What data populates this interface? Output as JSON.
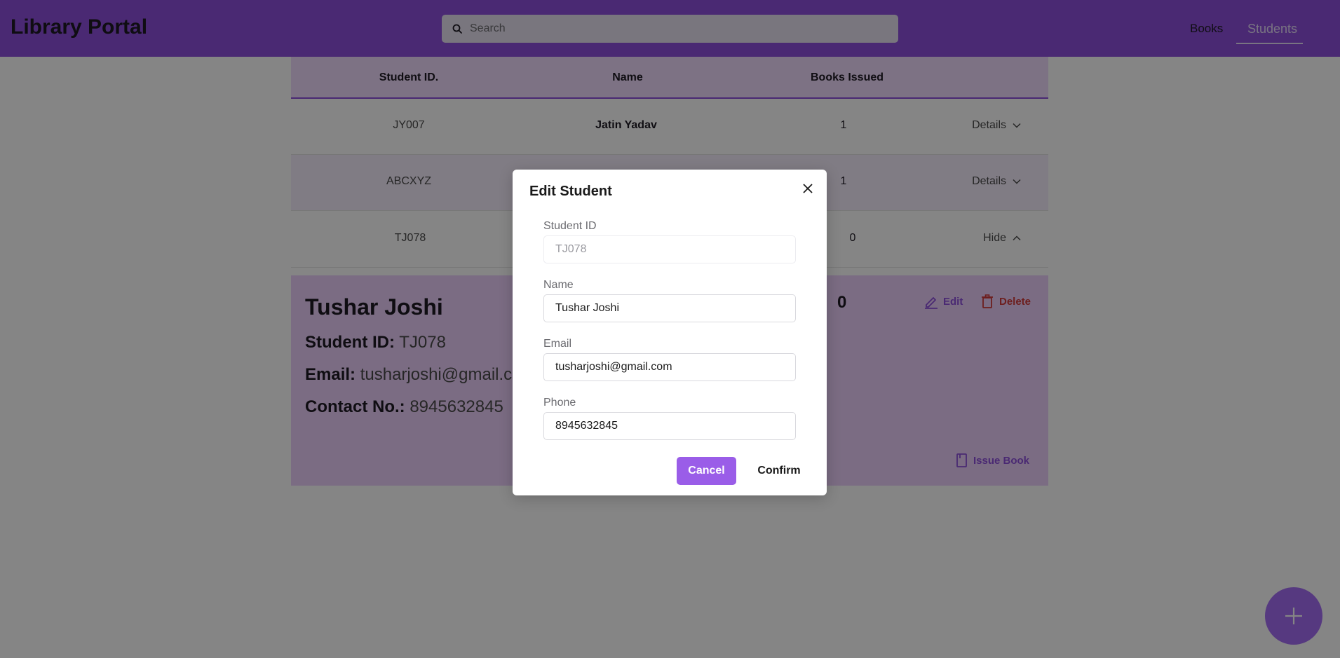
{
  "app": {
    "title": "Library Portal"
  },
  "search": {
    "placeholder": "Search"
  },
  "nav": {
    "books": "Books",
    "students": "Students"
  },
  "table": {
    "headers": [
      "Student ID.",
      "Name",
      "Books Issued"
    ],
    "rows": [
      {
        "id": "JY007",
        "name": "Jatin Yadav",
        "books": "1",
        "toggle": "Details"
      },
      {
        "id": "ABCXYZ",
        "name": "",
        "books": "1",
        "toggle": "Details"
      },
      {
        "id": "TJ078",
        "name": "",
        "books": "0",
        "toggle": "Hide"
      }
    ]
  },
  "details": {
    "name": "Tushar Joshi",
    "id_label": "Student ID:",
    "id_value": "TJ078",
    "email_label": "Email:",
    "email_value": "tusharjoshi@gmail.c",
    "contact_label": "Contact No.:",
    "contact_value": "8945632845",
    "books_count": "0",
    "edit_label": "Edit",
    "delete_label": "Delete",
    "issue_label": "Issue Book"
  },
  "modal": {
    "title": "Edit Student",
    "fields": {
      "student_id": {
        "label": "Student ID",
        "value": "TJ078"
      },
      "name": {
        "label": "Name",
        "value": "Tushar Joshi"
      },
      "email": {
        "label": "Email",
        "value": "tusharjoshi@gmail.com"
      },
      "phone": {
        "label": "Phone",
        "value": "8945632845"
      }
    },
    "cancel_label": "Cancel",
    "confirm_label": "Confirm"
  },
  "icons": {
    "search": "search-icon",
    "close": "close-icon",
    "chevron_down": "chevron-down-icon",
    "chevron_up": "chevron-up-icon",
    "edit": "pencil-icon",
    "delete": "trash-icon",
    "issue": "book-icon",
    "add": "plus-icon"
  },
  "colors": {
    "primary": "#8e4fdc",
    "danger": "#d23a3a",
    "fab": "#a66ef5"
  }
}
